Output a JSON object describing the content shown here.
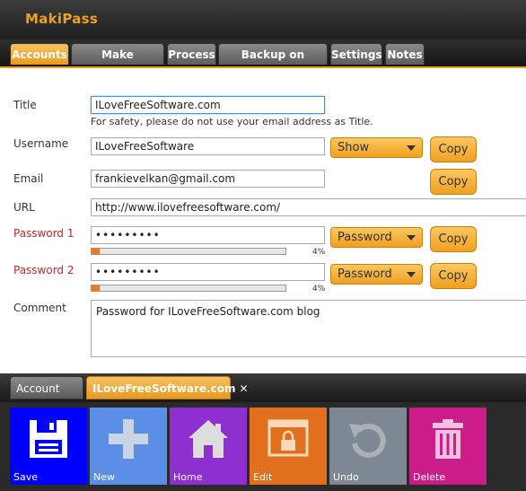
{
  "app": {
    "title": "MakiPass"
  },
  "tabs": [
    {
      "label": "Accounts",
      "active": true
    },
    {
      "label": "Make Passwords",
      "active": false
    },
    {
      "label": "Process",
      "active": false
    },
    {
      "label": "Backup on Demand",
      "active": false
    },
    {
      "label": "Settings",
      "active": false
    },
    {
      "label": "Notes",
      "active": false
    }
  ],
  "form": {
    "title_label": "Title",
    "title_value": "ILoveFreeSoftware.com",
    "title_hint": "For safety, please do not use your email address as Title.",
    "username_label": "Username",
    "username_value": "ILoveFreeSoftware",
    "username_mode": "Show",
    "email_label": "Email",
    "email_value": "frankievelkan@gmail.com",
    "url_label": "URL",
    "url_value": "http://www.ilovefreesoftware.com/",
    "password1_label": "Password 1",
    "password1_value": "•••••••••",
    "password1_mode": "Password",
    "password1_strength": "4%",
    "password1_strength_fraction": 0.04,
    "password2_label": "Password 2",
    "password2_value": "•••••••••",
    "password2_mode": "Password",
    "password2_strength": "4%",
    "password2_strength_fraction": 0.04,
    "comment_label": "Comment",
    "comment_value": "Password for ILoveFreeSoftware.com blog",
    "copy_label": "Copy"
  },
  "bottom_tabs": {
    "account_list": "Account List",
    "open_account": "ILoveFreeSoftware.com",
    "close_glyph": "✕"
  },
  "toolbar": {
    "save": "Save",
    "new": "New",
    "home": "Home",
    "edit": "Edit",
    "undo": "Undo",
    "delete": "Delete"
  },
  "colors": {
    "accent": "#f0a020",
    "save": "#0000ff",
    "new": "#5b8fe6",
    "home": "#8e2fd0",
    "edit": "#e0701e",
    "undo": "#7d8894",
    "delete": "#cc1c8a"
  }
}
